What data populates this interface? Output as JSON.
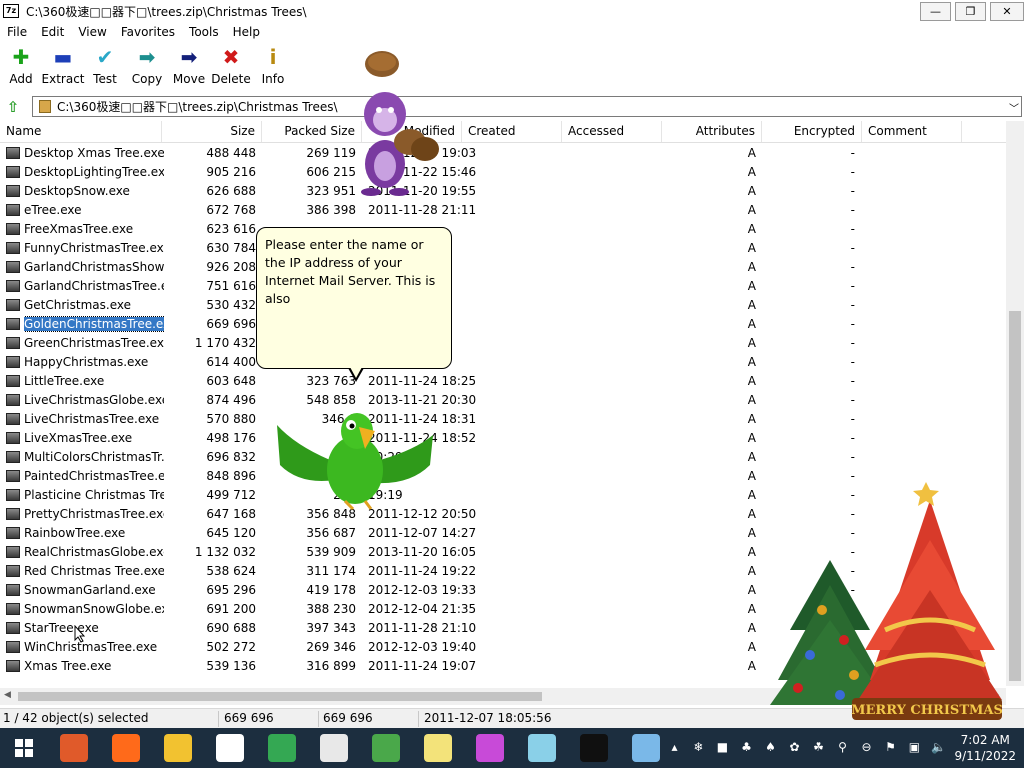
{
  "window": {
    "title": "C:\\360极速□□器下□\\trees.zip\\Christmas Trees\\",
    "app_icon": "7z",
    "controls": {
      "minimize": "—",
      "maximize": "❐",
      "close": "✕"
    }
  },
  "menu": [
    "File",
    "Edit",
    "View",
    "Favorites",
    "Tools",
    "Help"
  ],
  "toolbar": [
    {
      "label": "Add",
      "icon": "plus-icon",
      "glyph": "✚",
      "color": "#1aa31a"
    },
    {
      "label": "Extract",
      "icon": "minus-icon",
      "glyph": "▬",
      "color": "#1d3fb8"
    },
    {
      "label": "Test",
      "icon": "check-icon",
      "glyph": "✔",
      "color": "#2aa8c8"
    },
    {
      "label": "Copy",
      "icon": "copy-arrow-icon",
      "glyph": "➡",
      "color": "#1d8f8f"
    },
    {
      "label": "Move",
      "icon": "move-arrow-icon",
      "glyph": "➡",
      "color": "#14207a"
    },
    {
      "label": "Delete",
      "icon": "delete-x-icon",
      "glyph": "✖",
      "color": "#d01a1a"
    },
    {
      "label": "Info",
      "icon": "info-icon",
      "glyph": "i",
      "color": "#b88a10"
    }
  ],
  "address": {
    "path": "C:\\360极速□□器下□\\trees.zip\\Christmas Trees\\"
  },
  "columns": [
    "Name",
    "Size",
    "Packed Size",
    "Modified",
    "Created",
    "Accessed",
    "Attributes",
    "Encrypted",
    "Comment"
  ],
  "files": [
    {
      "name": "Desktop Xmas Tree.exe",
      "size": "488 448",
      "packed": "269 119",
      "modified": "2012-12-03 19:03",
      "attr": "A",
      "enc": "-"
    },
    {
      "name": "DesktopLightingTree.exe",
      "size": "905 216",
      "packed": "606 215",
      "modified": "2011-11-22 15:46",
      "attr": "A",
      "enc": "-"
    },
    {
      "name": "DesktopSnow.exe",
      "size": "626 688",
      "packed": "323 951",
      "modified": "2011-11-20 19:55",
      "attr": "A",
      "enc": "-"
    },
    {
      "name": "eTree.exe",
      "size": "672 768",
      "packed": "386 398",
      "modified": "2011-11-28 21:11",
      "attr": "A",
      "enc": "-"
    },
    {
      "name": "FreeXmasTree.exe",
      "size": "623 616",
      "packed": "",
      "modified": "",
      "attr": "A",
      "enc": "-"
    },
    {
      "name": "FunnyChristmasTree.exe",
      "size": "630 784",
      "packed": "",
      "modified": "",
      "attr": "A",
      "enc": "-"
    },
    {
      "name": "GarlandChristmasShow....",
      "size": "926 208",
      "packed": "",
      "modified": "",
      "attr": "A",
      "enc": "-"
    },
    {
      "name": "GarlandChristmasTree.e...",
      "size": "751 616",
      "packed": "",
      "modified": "",
      "attr": "A",
      "enc": "-"
    },
    {
      "name": "GetChristmas.exe",
      "size": "530 432",
      "packed": "",
      "modified": "",
      "attr": "A",
      "enc": "-"
    },
    {
      "name": "GoldenChristmasTree.exe",
      "size": "669 696",
      "packed": "",
      "modified": "",
      "attr": "A",
      "enc": "-",
      "selected": true
    },
    {
      "name": "GreenChristmasTree.exe",
      "size": "1 170 432",
      "packed": "",
      "modified": "",
      "attr": "A",
      "enc": "-"
    },
    {
      "name": "HappyChristmas.exe",
      "size": "614 400",
      "packed": "",
      "modified": "",
      "attr": "A",
      "enc": "-"
    },
    {
      "name": "LittleTree.exe",
      "size": "603 648",
      "packed": "323 763",
      "modified": "2011-11-24 18:25",
      "attr": "A",
      "enc": "-"
    },
    {
      "name": "LiveChristmasGlobe.exe",
      "size": "874 496",
      "packed": "548 858",
      "modified": "2013-11-21 20:30",
      "attr": "A",
      "enc": "-"
    },
    {
      "name": "LiveChristmasTree.exe",
      "size": "570 880",
      "packed": "346 6",
      "modified": "2011-11-24 18:31",
      "attr": "A",
      "enc": "-"
    },
    {
      "name": "LiveXmasTree.exe",
      "size": "498 176",
      "packed": "",
      "modified": "2011-11-24 18:52",
      "attr": "A",
      "enc": "-"
    },
    {
      "name": "MultiColorsChristmasTr...",
      "size": "696 832",
      "packed": "",
      "modified": "20:29",
      "attr": "A",
      "enc": "-"
    },
    {
      "name": "PaintedChristmasTree.exe",
      "size": "848 896",
      "packed": "",
      "modified": "21:12",
      "attr": "A",
      "enc": "-"
    },
    {
      "name": "Plasticine Christmas Tre...",
      "size": "499 712",
      "packed": "270",
      "modified": "19:19",
      "attr": "A",
      "enc": "-"
    },
    {
      "name": "PrettyChristmasTree.exe",
      "size": "647 168",
      "packed": "356 848",
      "modified": "2011-12-12 20:50",
      "attr": "A",
      "enc": "-"
    },
    {
      "name": "RainbowTree.exe",
      "size": "645 120",
      "packed": "356 687",
      "modified": "2011-12-07 14:27",
      "attr": "A",
      "enc": "-"
    },
    {
      "name": "RealChristmasGlobe.exe",
      "size": "1 132 032",
      "packed": "539 909",
      "modified": "2013-11-20 16:05",
      "attr": "A",
      "enc": "-"
    },
    {
      "name": "Red Christmas Tree.exe",
      "size": "538 624",
      "packed": "311 174",
      "modified": "2011-11-24 19:22",
      "attr": "A",
      "enc": "-"
    },
    {
      "name": "SnowmanGarland.exe",
      "size": "695 296",
      "packed": "419 178",
      "modified": "2012-12-03 19:33",
      "attr": "A",
      "enc": "-"
    },
    {
      "name": "SnowmanSnowGlobe.exe",
      "size": "691 200",
      "packed": "388 230",
      "modified": "2012-12-04 21:35",
      "attr": "A",
      "enc": "-"
    },
    {
      "name": "StarTree.exe",
      "size": "690 688",
      "packed": "397 343",
      "modified": "2011-11-28 21:10",
      "attr": "A",
      "enc": "-"
    },
    {
      "name": "WinChristmasTree.exe",
      "size": "502 272",
      "packed": "269 346",
      "modified": "2012-12-03 19:40",
      "attr": "A",
      "enc": "-"
    },
    {
      "name": "Xmas Tree.exe",
      "size": "539 136",
      "packed": "316 899",
      "modified": "2011-11-24 19:07",
      "attr": "A",
      "enc": "-"
    }
  ],
  "status": {
    "selection": "1 / 42 object(s) selected",
    "size": "669 696",
    "packed": "669 696",
    "modified": "2011-12-07 18:05:56"
  },
  "bubble": {
    "text": "Please enter the name or the IP address of your Internet Mail Server. This is also"
  },
  "overlay_text": {
    "merry_christmas": "MERRY CHRISTMAS"
  },
  "taskbar": {
    "apps": [
      {
        "name": "browser-360-icon",
        "color": "#e05a2a"
      },
      {
        "name": "firefox-icon",
        "color": "#ff6a1a"
      },
      {
        "name": "file-explorer-icon",
        "color": "#f2c230"
      },
      {
        "name": "yandex-icon",
        "color": "#ffffff"
      },
      {
        "name": "chrome-icon",
        "color": "#34a853"
      },
      {
        "name": "7zip-icon",
        "color": "#e8e8e8"
      },
      {
        "name": "green-app-icon",
        "color": "#4aa84a"
      },
      {
        "name": "sticky-notes-icon",
        "color": "#f3e37a"
      },
      {
        "name": "3d-shape-icon",
        "color": "#c84ad8"
      },
      {
        "name": "notepad-icon",
        "color": "#8ad0e8"
      },
      {
        "name": "cmd-icon",
        "color": "#101010"
      },
      {
        "name": "monitor-icon",
        "color": "#7ab8e8"
      }
    ],
    "time": "7:02 AM",
    "date": "9/11/2022"
  }
}
